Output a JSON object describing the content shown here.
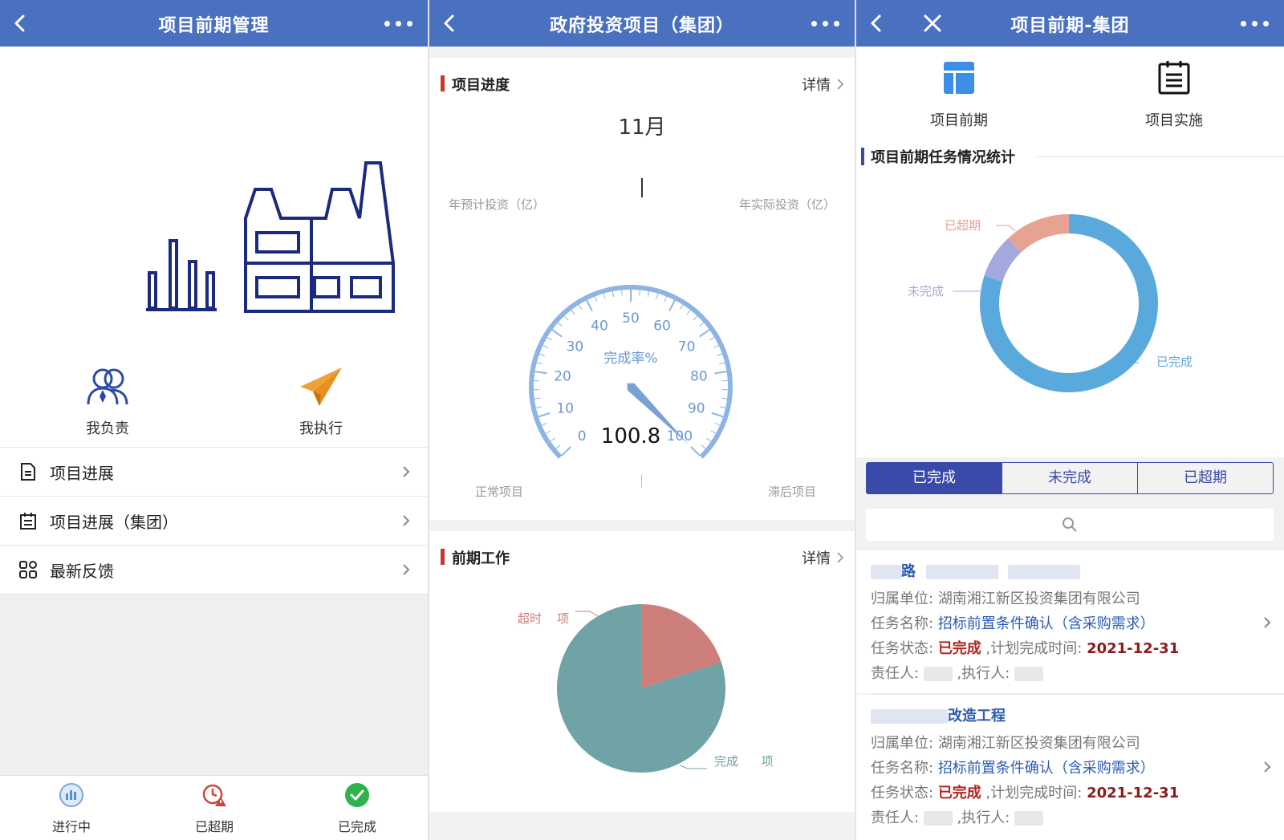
{
  "screen1": {
    "title": "项目前期管理",
    "quick_actions": [
      {
        "label": "我负责",
        "icon": "people-icon"
      },
      {
        "label": "我执行",
        "icon": "paper-plane-icon"
      }
    ],
    "menu": [
      {
        "label": "项目进展",
        "icon": "document-icon"
      },
      {
        "label": "项目进展（集团）",
        "icon": "calendar-icon"
      },
      {
        "label": "最新反馈",
        "icon": "grid-icon"
      }
    ],
    "tabs": [
      {
        "label": "进行中",
        "icon": "bar-chart-circle-icon"
      },
      {
        "label": "已超期",
        "icon": "alarm-warning-icon"
      },
      {
        "label": "已完成",
        "icon": "check-circle-icon"
      }
    ]
  },
  "screen2": {
    "title": "政府投资项目（集团）",
    "progress_card": {
      "title": "项目进度",
      "more": "详情",
      "month": "11月",
      "left_label": "年预计投资（亿）",
      "right_label": "年实际投资（亿）",
      "bottom_left": "正常项目",
      "bottom_right": "滞后项目",
      "gauge": {
        "name": "完成率%",
        "value_text": "100.8",
        "value": 100.8,
        "min": 0,
        "max": 100,
        "ticks": [
          "0",
          "10",
          "20",
          "30",
          "40",
          "50",
          "60",
          "70",
          "80",
          "90",
          "100"
        ]
      }
    },
    "prework_card": {
      "title": "前期工作",
      "more": "详情",
      "pie_labels": {
        "overdue": "超时",
        "overdue_unit": "项",
        "done": "完成",
        "done_unit": "项"
      },
      "pie": [
        {
          "name": "超时",
          "share": 0.2,
          "color": "#cd7f7b"
        },
        {
          "name": "完成",
          "share": 0.8,
          "color": "#6fa3a6"
        }
      ]
    }
  },
  "screen3": {
    "title": "项目前期-集团",
    "top_items": [
      {
        "label": "项目前期",
        "icon": "layout-icon"
      },
      {
        "label": "项目实施",
        "icon": "clipboard-icon"
      }
    ],
    "section_title": "项目前期任务情况统计",
    "donut": [
      {
        "name": "已完成",
        "share": 0.8,
        "color": "#5aa9dc"
      },
      {
        "name": "未完成",
        "share": 0.08,
        "color": "#a5a8df"
      },
      {
        "name": "已超期",
        "share": 0.12,
        "color": "#e6a293"
      }
    ],
    "segments": [
      "已完成",
      "未完成",
      "已超期"
    ],
    "active_segment": "已完成",
    "items": [
      {
        "title_suffix": "路",
        "unit_label": "归属单位:",
        "unit": "湖南湘江新区投资集团有限公司",
        "task_label": "任务名称:",
        "task": "招标前置条件确认（含采购需求）",
        "status_label": "任务状态:",
        "status": "已完成",
        "plan_label": ",计划完成时间:",
        "plan_date": "2021-12-31",
        "owner_label": "责任人:",
        "exec_label": ",执行人:"
      },
      {
        "title_suffix": "改造工程",
        "unit_label": "归属单位:",
        "unit": "湖南湘江新区投资集团有限公司",
        "task_label": "任务名称:",
        "task": "招标前置条件确认（含采购需求）",
        "status_label": "任务状态:",
        "status": "已完成",
        "plan_label": ",计划完成时间:",
        "plan_date": "2021-12-31",
        "owner_label": "责任人:",
        "exec_label": ",执行人:"
      }
    ]
  },
  "colors": {
    "header": "#4a71c0",
    "accent_navy": "#3a4aa8",
    "link_blue": "#2c5cb3",
    "status_red": "#b3261e",
    "gauge_blue": "#8db4e2"
  }
}
